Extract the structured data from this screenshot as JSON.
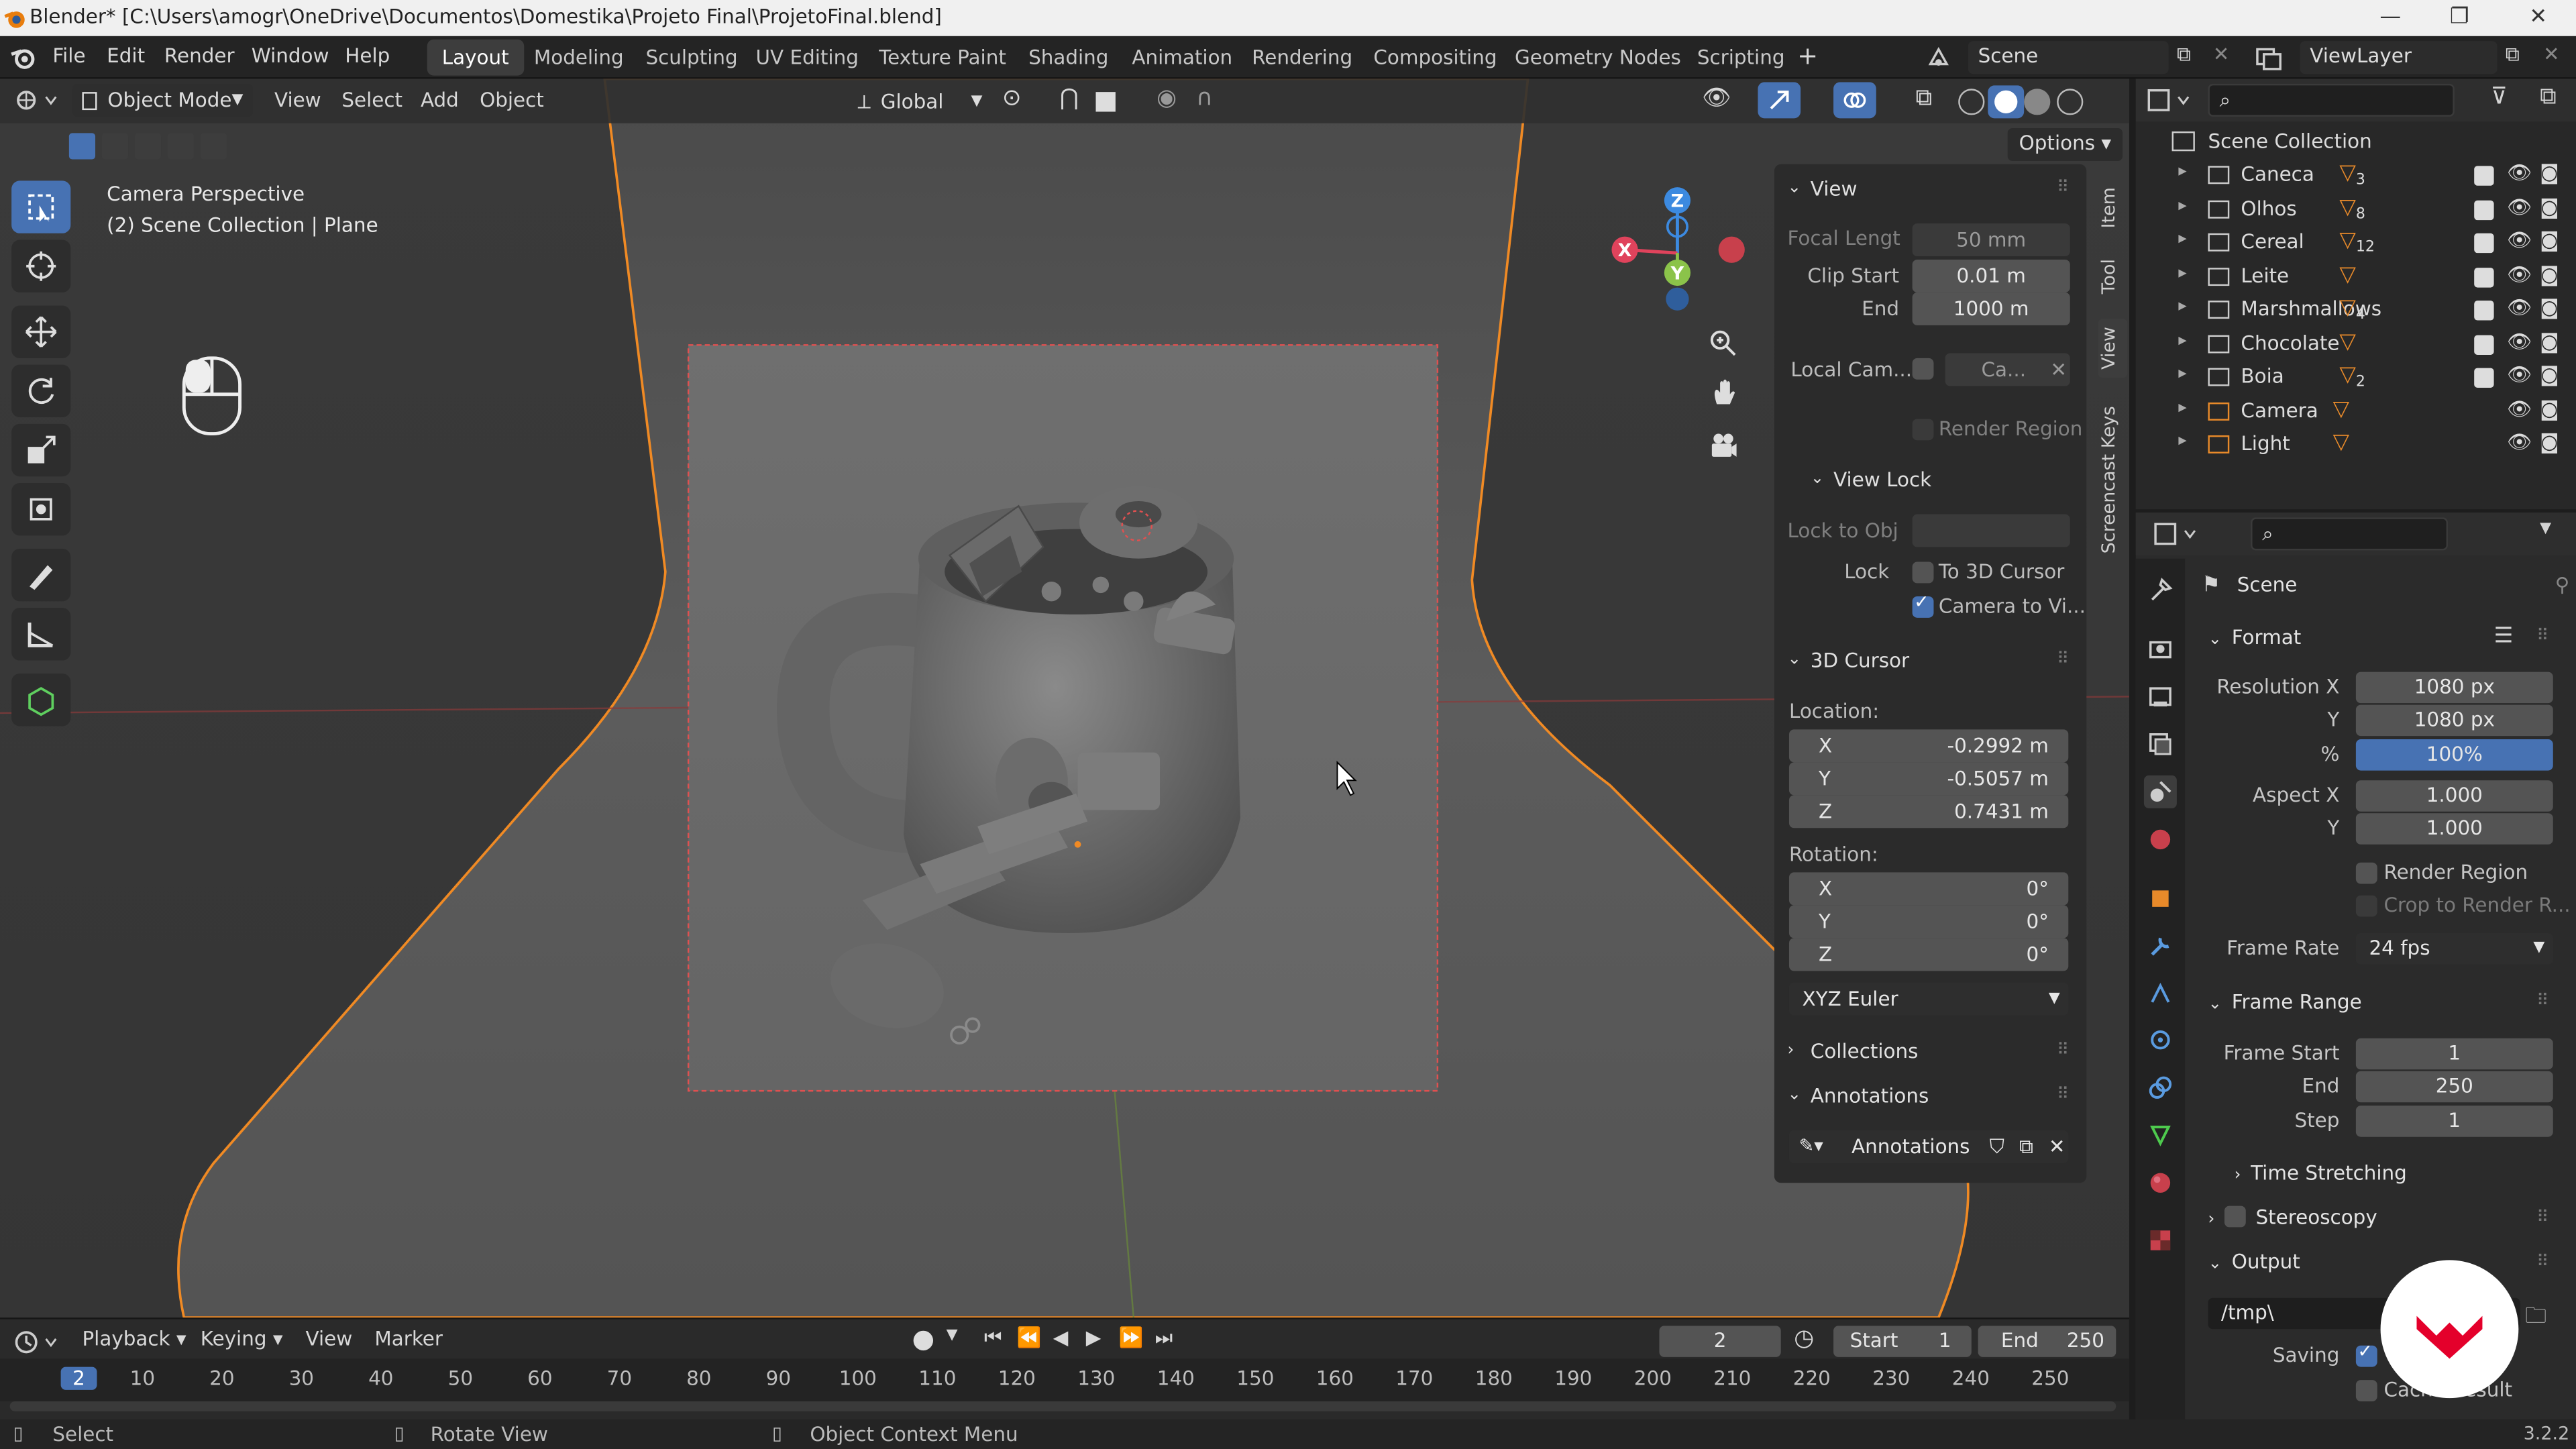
{
  "window": {
    "title": "Blender* [C:\\Users\\amogr\\OneDrive\\Documentos\\Domestika\\Projeto Final\\ProjetoFinal.blend]"
  },
  "menu": [
    "File",
    "Edit",
    "Render",
    "Window",
    "Help"
  ],
  "workspaces": [
    "Layout",
    "Modeling",
    "Sculpting",
    "UV Editing",
    "Texture Paint",
    "Shading",
    "Animation",
    "Rendering",
    "Compositing",
    "Geometry Nodes",
    "Scripting"
  ],
  "active_workspace": "Layout",
  "scene_selector": "Scene",
  "viewlayer_selector": "ViewLayer",
  "viewport_header": {
    "mode": "Object Mode",
    "menus": [
      "View",
      "Select",
      "Add",
      "Object"
    ],
    "orientation": "Global",
    "options": "Options"
  },
  "viewport": {
    "camera_label": "Camera Perspective",
    "collection_label": "(2) Scene Collection | Plane"
  },
  "gizmo": {
    "x": "X",
    "y": "Y",
    "z": "Z"
  },
  "side_tabs": [
    "Item",
    "Tool",
    "View",
    "Screencast Keys"
  ],
  "npanel": {
    "view": {
      "title": "View",
      "focal_label": "Focal Lengt",
      "focal_value": "50 mm",
      "clip_start_label": "Clip Start",
      "clip_start_value": "0.01 m",
      "end_label": "End",
      "end_value": "1000 m",
      "local_cam_label": "Local Cam...",
      "local_cam_value": "Ca...",
      "render_region": "Render Region"
    },
    "view_lock": {
      "title": "View Lock",
      "lock_to_obj": "Lock to Obj",
      "lock_label": "Lock",
      "to_3d_cursor": "To 3D Cursor",
      "camera_to_view": "Camera to Vi..."
    },
    "cursor": {
      "title": "3D Cursor",
      "location_label": "Location:",
      "x_label": "X",
      "x": "-0.2992 m",
      "y_label": "Y",
      "y": "-0.5057 m",
      "z_label": "Z",
      "z": "0.7431 m",
      "rotation_label": "Rotation:",
      "rx": "0°",
      "ry": "0°",
      "rz": "0°",
      "mode": "XYZ Euler"
    },
    "collections": "Collections",
    "annotations": {
      "title": "Annotations",
      "field": "Annotations"
    }
  },
  "outliner": {
    "root": "Scene Collection",
    "items": [
      {
        "name": "Caneca",
        "badge": "3"
      },
      {
        "name": "Olhos",
        "badge": "8"
      },
      {
        "name": "Cereal",
        "badge": "12"
      },
      {
        "name": "Leite",
        "badge": ""
      },
      {
        "name": "Marshmallows",
        "badge": "4"
      },
      {
        "name": "Chocolate",
        "badge": ""
      },
      {
        "name": "Boia",
        "badge": "2"
      },
      {
        "name": "Camera",
        "badge": ""
      },
      {
        "name": "Light",
        "badge": ""
      }
    ]
  },
  "properties": {
    "context": "Scene",
    "format": {
      "title": "Format",
      "res_x_label": "Resolution X",
      "res_x": "1080 px",
      "res_y_label": "Y",
      "res_y": "1080 px",
      "pct_label": "%",
      "pct": "100%",
      "aspect_x_label": "Aspect X",
      "aspect_x": "1.000",
      "aspect_y_label": "Y",
      "aspect_y": "1.000",
      "render_region": "Render Region",
      "crop": "Crop to Render R...",
      "frame_rate_label": "Frame Rate",
      "frame_rate": "24 fps"
    },
    "frame_range": {
      "title": "Frame Range",
      "start_label": "Frame Start",
      "start": "1",
      "end_label": "End",
      "end": "250",
      "step_label": "Step",
      "step": "1"
    },
    "time_stretching": "Time Stretching",
    "stereoscopy": "Stereoscopy",
    "output": {
      "title": "Output",
      "path": "/tmp\\",
      "saving_label": "Saving",
      "cache_result": "Cache Result"
    }
  },
  "timeline": {
    "menus": [
      "Playback",
      "Keying",
      "View",
      "Marker"
    ],
    "current_frame": "2",
    "start_label": "Start",
    "start": "1",
    "end_label": "End",
    "end": "250",
    "ticks": [
      "2",
      "10",
      "20",
      "30",
      "40",
      "50",
      "60",
      "70",
      "80",
      "90",
      "100",
      "110",
      "120",
      "130",
      "140",
      "150",
      "160",
      "170",
      "180",
      "190",
      "200",
      "210",
      "220",
      "230",
      "240",
      "250"
    ]
  },
  "status": {
    "select": "Select",
    "rotate": "Rotate View",
    "context_menu": "Object Context Menu",
    "version": "3.2.2"
  },
  "colors": {
    "accent": "#4772b3",
    "selection_orange": "#f08a24",
    "axis_x": "#e0435c",
    "axis_y": "#8bc34a",
    "axis_z": "#3c8ae0",
    "watermark": "#e4002b"
  }
}
